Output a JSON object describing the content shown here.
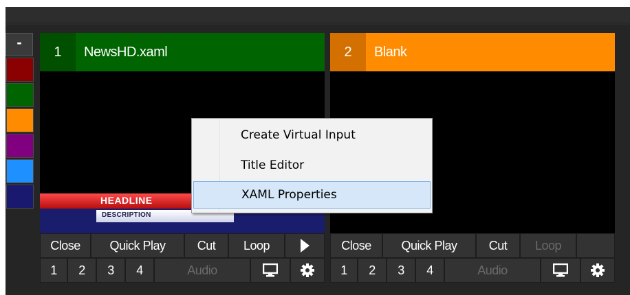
{
  "colors": {
    "strip": [
      "#8b0000",
      "#006400",
      "#ff8c00",
      "#800080",
      "#1e90ff",
      "#191970"
    ],
    "input1_accent": "#006400",
    "input1_num_bg": "#005000",
    "input2_accent": "#ff8c00",
    "input2_num_bg": "#d47000"
  },
  "color_strip": {
    "collapse_label": "-"
  },
  "inputs": [
    {
      "number": "1",
      "title": "NewsHD.xaml",
      "lower_third": {
        "headline": "HEADLINE",
        "description": "DESCRIPTION"
      },
      "buttons": {
        "close": "Close",
        "quick_play": "Quick Play",
        "cut": "Cut",
        "loop": "Loop",
        "play_icon": "play-icon"
      },
      "overlays": [
        "1",
        "2",
        "3",
        "4"
      ],
      "audio": "Audio",
      "monitor_icon": "monitor-icon",
      "settings_icon": "gear-icon"
    },
    {
      "number": "2",
      "title": "Blank",
      "buttons": {
        "close": "Close",
        "quick_play": "Quick Play",
        "cut": "Cut",
        "loop": "Loop"
      },
      "overlays": [
        "1",
        "2",
        "3",
        "4"
      ],
      "audio": "Audio",
      "monitor_icon": "monitor-icon",
      "settings_icon": "gear-icon"
    }
  ],
  "context_menu": {
    "items": [
      "Create Virtual Input",
      "Title Editor",
      "XAML Properties"
    ],
    "highlighted": "XAML Properties"
  }
}
